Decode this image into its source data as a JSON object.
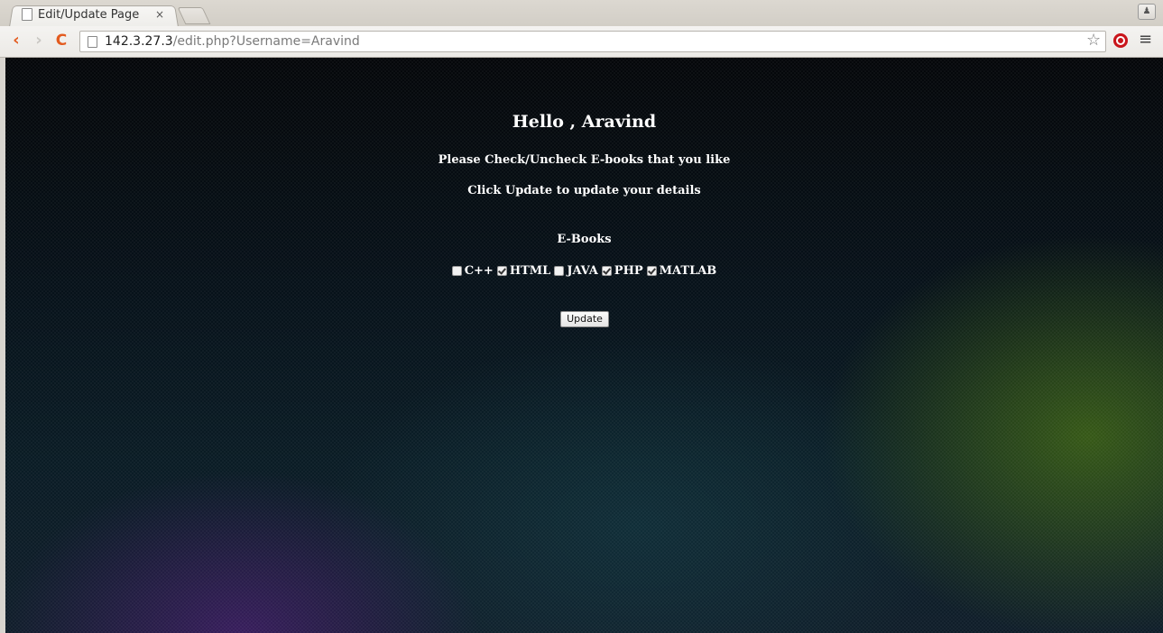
{
  "browser": {
    "tab": {
      "title": "Edit/Update Page",
      "close_glyph": "×"
    },
    "profile_glyph": "☺",
    "address": {
      "host": "142.3.27.3",
      "path": "/edit.php?Username=Aravind"
    },
    "icons": {
      "back": "‹",
      "forward": "›",
      "reload": "C",
      "star": "☆",
      "menu": "≡"
    }
  },
  "page": {
    "greeting": "Hello , Aravind",
    "instruction_1": "Please Check/Uncheck E-books that you like",
    "instruction_2": "Click Update to update your details",
    "ebooks_heading": "E-Books",
    "ebooks": [
      {
        "label": "C++",
        "checked": false
      },
      {
        "label": "HTML",
        "checked": true
      },
      {
        "label": "JAVA",
        "checked": false
      },
      {
        "label": "PHP",
        "checked": true
      },
      {
        "label": "MATLAB",
        "checked": true
      }
    ],
    "update_button": "Update"
  }
}
